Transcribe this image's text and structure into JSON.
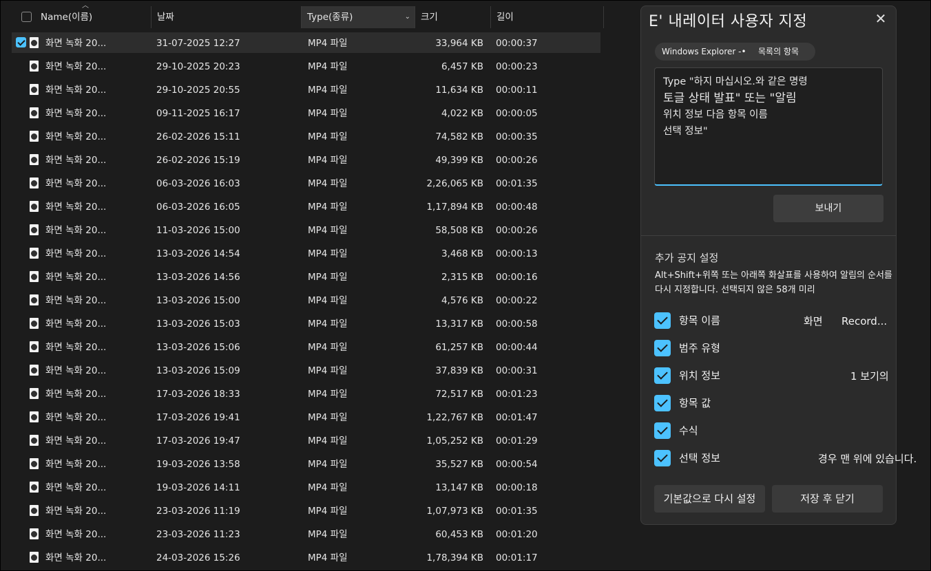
{
  "header": {
    "name": "Name(이름)",
    "date": "날짜",
    "type": "Type(종류)",
    "size": "크기",
    "length": "길이"
  },
  "rows": [
    {
      "name": "화면 녹화 20...",
      "date": "31-07-2025 12:27",
      "type": "MP4 파일",
      "size": "33,964 KB",
      "length": "00:00:37"
    },
    {
      "name": "화면 녹화 20...",
      "date": "29-10-2025 20:23",
      "type": "MP4 파일",
      "size": "6,457 KB",
      "length": "00:00:23"
    },
    {
      "name": "화면 녹화 20...",
      "date": "29-10-2025 20:55",
      "type": "MP4 파일",
      "size": "11,634 KB",
      "length": "00:00:11"
    },
    {
      "name": "화면 녹화 20...",
      "date": "09-11-2025 16:17",
      "type": "MP4 파일",
      "size": "4,022 KB",
      "length": "00:00:05"
    },
    {
      "name": "화면 녹화 20...",
      "date": "26-02-2026 15:11",
      "type": "MP4 파일",
      "size": "74,582 KB",
      "length": "00:00:35"
    },
    {
      "name": "화면 녹화 20...",
      "date": "26-02-2026 15:19",
      "type": "MP4 파일",
      "size": "49,399 KB",
      "length": "00:00:26"
    },
    {
      "name": "화면 녹화 20...",
      "date": "06-03-2026 16:03",
      "type": "MP4 파일",
      "size": "2,26,065 KB",
      "length": "00:01:35"
    },
    {
      "name": "화면 녹화 20...",
      "date": "06-03-2026 16:05",
      "type": "MP4 파일",
      "size": "1,17,894 KB",
      "length": "00:00:48"
    },
    {
      "name": "화면 녹화 20...",
      "date": "11-03-2026 15:00",
      "type": "MP4 파일",
      "size": "58,508 KB",
      "length": "00:00:26"
    },
    {
      "name": "화면 녹화 20...",
      "date": "13-03-2026 14:54",
      "type": "MP4 파일",
      "size": "3,468 KB",
      "length": "00:00:13"
    },
    {
      "name": "화면 녹화 20...",
      "date": "13-03-2026 14:56",
      "type": "MP4 파일",
      "size": "2,315 KB",
      "length": "00:00:16"
    },
    {
      "name": "화면 녹화 20...",
      "date": "13-03-2026 15:00",
      "type": "MP4 파일",
      "size": "4,576 KB",
      "length": "00:00:22"
    },
    {
      "name": "화면 녹화 20...",
      "date": "13-03-2026 15:03",
      "type": "MP4 파일",
      "size": "13,317 KB",
      "length": "00:00:58"
    },
    {
      "name": "화면 녹화 20...",
      "date": "13-03-2026 15:06",
      "type": "MP4 파일",
      "size": "61,257 KB",
      "length": "00:00:44"
    },
    {
      "name": "화면 녹화 20...",
      "date": "13-03-2026 15:09",
      "type": "MP4 파일",
      "size": "37,839 KB",
      "length": "00:00:31"
    },
    {
      "name": "화면 녹화 20...",
      "date": "17-03-2026 18:33",
      "type": "MP4 파일",
      "size": "72,517 KB",
      "length": "00:01:23"
    },
    {
      "name": "화면 녹화 20...",
      "date": "17-03-2026 19:41",
      "type": "MP4 파일",
      "size": "1,22,767 KB",
      "length": "00:01:47"
    },
    {
      "name": "화면 녹화 20...",
      "date": "17-03-2026 19:47",
      "type": "MP4 파일",
      "size": "1,05,252 KB",
      "length": "00:01:29"
    },
    {
      "name": "화면 녹화 20...",
      "date": "19-03-2026 13:58",
      "type": "MP4 파일",
      "size": "35,527 KB",
      "length": "00:00:54"
    },
    {
      "name": "화면 녹화 20...",
      "date": "19-03-2026 14:11",
      "type": "MP4 파일",
      "size": "13,147 KB",
      "length": "00:00:18"
    },
    {
      "name": "화면 녹화 20...",
      "date": "23-03-2026 11:19",
      "type": "MP4 파일",
      "size": "1,07,973 KB",
      "length": "00:01:35"
    },
    {
      "name": "화면 녹화 20...",
      "date": "23-03-2026 11:23",
      "type": "MP4 파일",
      "size": "60,453 KB",
      "length": "00:01:20"
    },
    {
      "name": "화면 녹화 20...",
      "date": "24-03-2026 15:26",
      "type": "MP4 파일",
      "size": "1,78,394 KB",
      "length": "00:01:17"
    }
  ],
  "selected_row": 0,
  "dialog": {
    "title": "E' 내레이터 사용자 지정",
    "close_glyph": "✕",
    "scope_left": "Windows Explorer -•",
    "scope_right": "목록의 항목",
    "text_lines": [
      "Type \"하지 마십시오.와 같은 명령",
      "토글 상태 발표\" 또는 \"알림",
      "위치 정보 다음 항목 이름",
      "선택 정보\""
    ],
    "send_label": "보내기",
    "section_title": "추가 공지 설정",
    "section_desc": "Alt+Shift+위쪽 또는 아래쪽 화살표를 사용하여 알림의 순서를 다시 지정합니다. 선택되지 않은 58개 미리",
    "options": [
      {
        "label": "항목 이름",
        "extra1": "화면",
        "extra2": "Record..."
      },
      {
        "label": "범주 유형",
        "extra1": "",
        "extra2": ""
      },
      {
        "label": "위치 정보",
        "extra1": "",
        "extra2": "1 보기의"
      },
      {
        "label": "항목 값",
        "extra1": "",
        "extra2": ""
      },
      {
        "label": "수식",
        "extra1": "",
        "extra2": ""
      },
      {
        "label": "선택 정보",
        "extra1": "",
        "extra2": "경우 맨 위에 있습니다."
      }
    ],
    "reset_label": "기본값으로 다시 설정",
    "save_label": "저장 후 닫기"
  },
  "colors": {
    "accent": "#4cc2ff",
    "background": "#1c1c1c",
    "dialog_bg": "#2b2b2b"
  }
}
